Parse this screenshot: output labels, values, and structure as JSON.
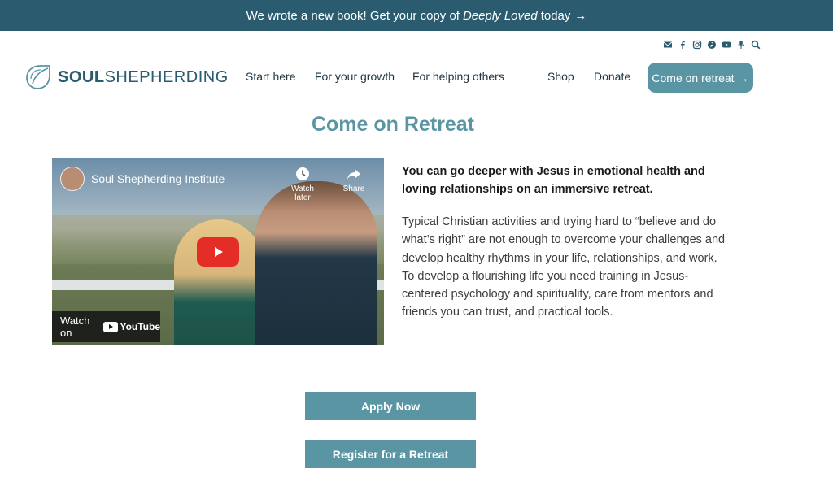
{
  "announcement": {
    "prefix": "We wrote a new book! Get your copy of",
    "book_title": "Deeply Loved",
    "suffix": "today",
    "arrow": "→"
  },
  "social_icons": [
    "email-icon",
    "facebook-icon",
    "instagram-icon",
    "pinterest-icon",
    "youtube-icon",
    "microphone-icon",
    "search-icon"
  ],
  "logo": {
    "word_bold": "SOUL",
    "word_light": "SHEPHERDING"
  },
  "nav": {
    "start_here": "Start here",
    "for_your_growth": "For your growth",
    "for_helping_others": "For helping others",
    "shop": "Shop",
    "donate": "Donate"
  },
  "cta": {
    "label": "Come on retreat",
    "arrow": "→"
  },
  "page_title": "Come on Retreat",
  "video": {
    "channel_name": "Soul Shepherding Institute",
    "watch_later": "Watch later",
    "share": "Share",
    "watch_on": "Watch on",
    "youtube": "YouTube"
  },
  "content": {
    "lead": "You can go deeper with Jesus in emotional health and loving relationships on an immersive retreat.",
    "body": "Typical Christian activities and trying hard to “believe and do what’s right” are not enough to overcome your challenges and develop healthy rhythms in your life, relationships, and work. To develop a flourishing life you need training in Jesus-centered psychology and spirituality, care from mentors and friends you can trust, and practical tools."
  },
  "buttons": {
    "apply": "Apply Now",
    "register": "Register for a Retreat"
  },
  "colors": {
    "topbar": "#2a5b6e",
    "accent": "#5a95a3",
    "youtube_red": "#e52d27"
  }
}
